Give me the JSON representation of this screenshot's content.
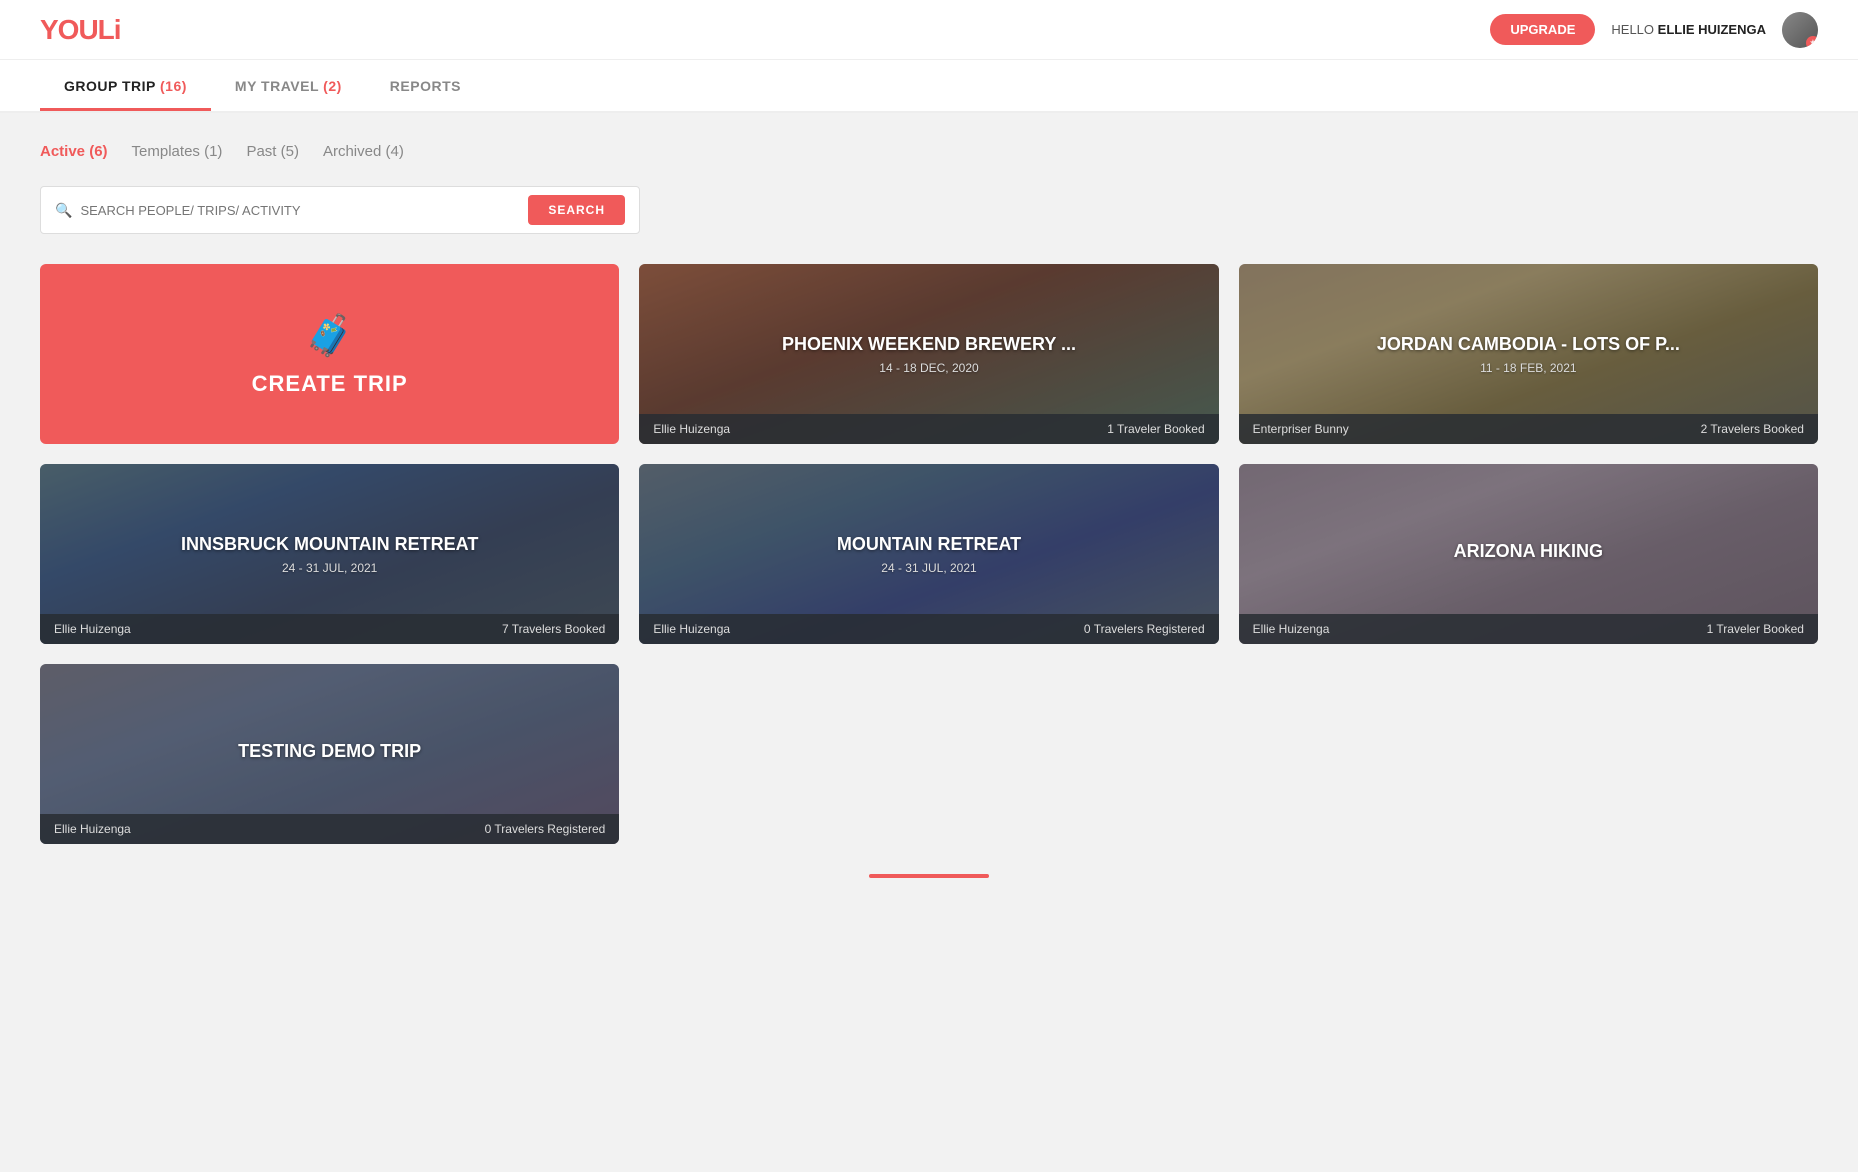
{
  "header": {
    "logo": "YOULi",
    "upgrade_label": "UPGRADE",
    "hello_prefix": "HELLO",
    "user_name": "ELLIE HUIZENGA"
  },
  "main_nav": {
    "tabs": [
      {
        "id": "group-trip",
        "label": "GROUP TRIP",
        "count": 16,
        "active": true
      },
      {
        "id": "my-travel",
        "label": "MY TRAVEL",
        "count": 2,
        "active": false
      },
      {
        "id": "reports",
        "label": "REPORTS",
        "count": null,
        "active": false
      }
    ]
  },
  "sub_nav": {
    "tabs": [
      {
        "id": "active",
        "label": "Active",
        "count": 6,
        "active": true
      },
      {
        "id": "templates",
        "label": "Templates",
        "count": 1,
        "active": false
      },
      {
        "id": "past",
        "label": "Past",
        "count": 5,
        "active": false
      },
      {
        "id": "archived",
        "label": "Archived",
        "count": 4,
        "active": false
      }
    ]
  },
  "search": {
    "placeholder": "SEARCH PEOPLE/ TRIPS/ ACTIVITY",
    "button_label": "SEARCH"
  },
  "create_card": {
    "label": "CREATE TRIP"
  },
  "trips": [
    {
      "id": "phoenix",
      "title": "PHOENIX WEEKEND BREWERY ...",
      "dates": "14 - 18 DEC, 2020",
      "organizer": "Ellie Huizenga",
      "travelers": "1 Traveler Booked",
      "bg_class": "bg-mountain-red"
    },
    {
      "id": "jordan",
      "title": "JORDAN CAMBODIA - LOTS OF P...",
      "dates": "11 - 18 FEB, 2021",
      "organizer": "Enterpriser Bunny",
      "travelers": "2 Travelers Booked",
      "bg_class": "bg-jordan"
    },
    {
      "id": "innsbruck",
      "title": "INNSBRUCK MOUNTAIN RETREAT",
      "dates": "24 - 31 JUL, 2021",
      "organizer": "Ellie Huizenga",
      "travelers": "7 Travelers Booked",
      "bg_class": "bg-innsbruck"
    },
    {
      "id": "mountain-retreat",
      "title": "MOUNTAIN RETREAT",
      "dates": "24 - 31 JUL, 2021",
      "organizer": "Ellie Huizenga",
      "travelers": "0 Travelers Registered",
      "bg_class": "bg-mountain2"
    },
    {
      "id": "arizona",
      "title": "ARIZONA HIKING",
      "dates": "",
      "organizer": "Ellie Huizenga",
      "travelers": "1 Traveler Booked",
      "bg_class": "bg-arizona"
    },
    {
      "id": "testing-demo",
      "title": "TESTING DEMO TRIP",
      "dates": "",
      "organizer": "Ellie Huizenga",
      "travelers": "0 Travelers Registered",
      "bg_class": "bg-testing"
    }
  ],
  "colors": {
    "brand": "#f05a5a",
    "dark_overlay": "rgba(40,45,50,0.85)"
  }
}
